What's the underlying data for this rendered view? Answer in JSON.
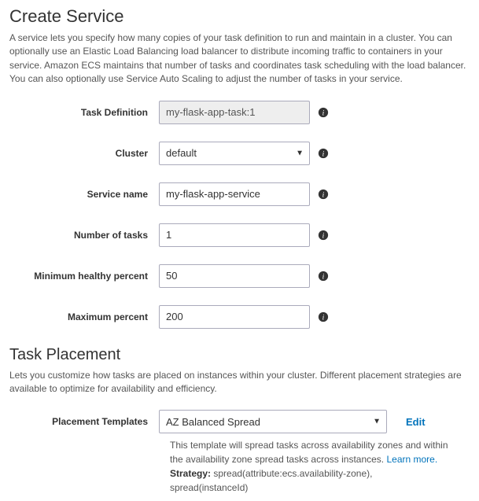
{
  "header": {
    "title": "Create Service",
    "description": "A service lets you specify how many copies of your task definition to run and maintain in a cluster. You can optionally use an Elastic Load Balancing load balancer to distribute incoming traffic to containers in your service. Amazon ECS maintains that number of tasks and coordinates task scheduling with the load balancer. You can also optionally use Service Auto Scaling to adjust the number of tasks in your service."
  },
  "form": {
    "task_definition": {
      "label": "Task Definition",
      "value": "my-flask-app-task:1"
    },
    "cluster": {
      "label": "Cluster",
      "value": "default"
    },
    "service_name": {
      "label": "Service name",
      "value": "my-flask-app-service"
    },
    "number_of_tasks": {
      "label": "Number of tasks",
      "value": "1"
    },
    "min_healthy": {
      "label": "Minimum healthy percent",
      "value": "50"
    },
    "max_percent": {
      "label": "Maximum percent",
      "value": "200"
    }
  },
  "placement": {
    "title": "Task Placement",
    "description": "Lets you customize how tasks are placed on instances within your cluster. Different placement strategies are available to optimize for availability and efficiency.",
    "templates_label": "Placement Templates",
    "templates_value": "AZ Balanced Spread",
    "edit_label": "Edit",
    "help_text": "This template will spread tasks across availability zones and within the availability zone spread tasks across instances.",
    "learn_more": "Learn more.",
    "strategy_label": "Strategy:",
    "strategy_value": "spread(attribute:ecs.availability-zone), spread(instanceId)"
  }
}
